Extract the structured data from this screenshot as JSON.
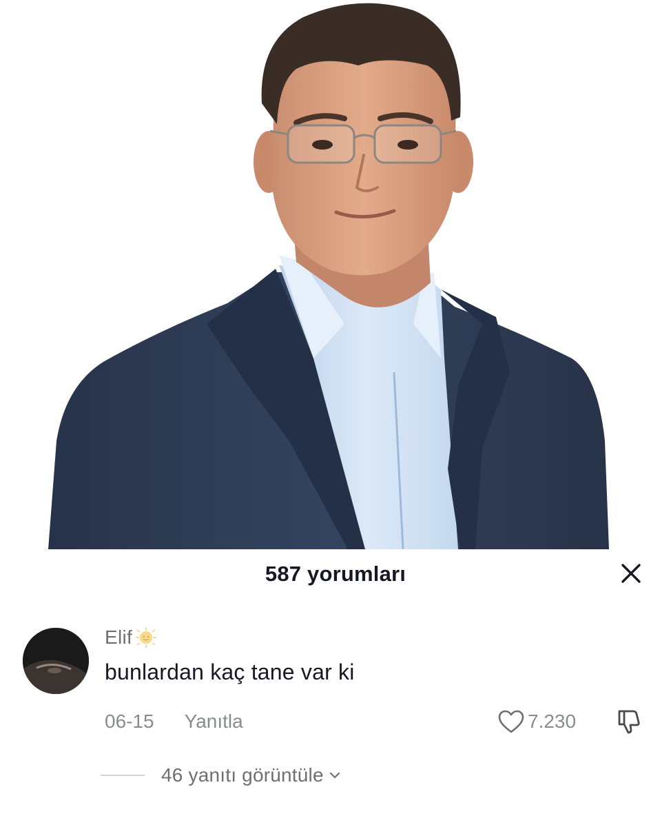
{
  "photo": {
    "subject": "man-in-suit-portrait"
  },
  "comments_panel": {
    "title": "587 yorumları",
    "close_icon": "close-icon"
  },
  "comment": {
    "author": "Elif",
    "author_badge_icon": "smiling-sun-emoji-icon",
    "text": "bunlardan kaç tane var ki",
    "date": "06-15",
    "reply_label": "Yanıtla",
    "like_icon": "heart-outline-icon",
    "like_count": "7.230",
    "dislike_icon": "thumbs-down-outline-icon"
  },
  "replies": {
    "label": "46 yanıtı görüntüle",
    "chevron_icon": "chevron-down-icon"
  },
  "colors": {
    "primary_text": "#161823",
    "secondary_text": "#8a8b91",
    "author_text": "#6f6f72",
    "suit": "#2c3a52",
    "shirt": "#cfe0f2"
  }
}
